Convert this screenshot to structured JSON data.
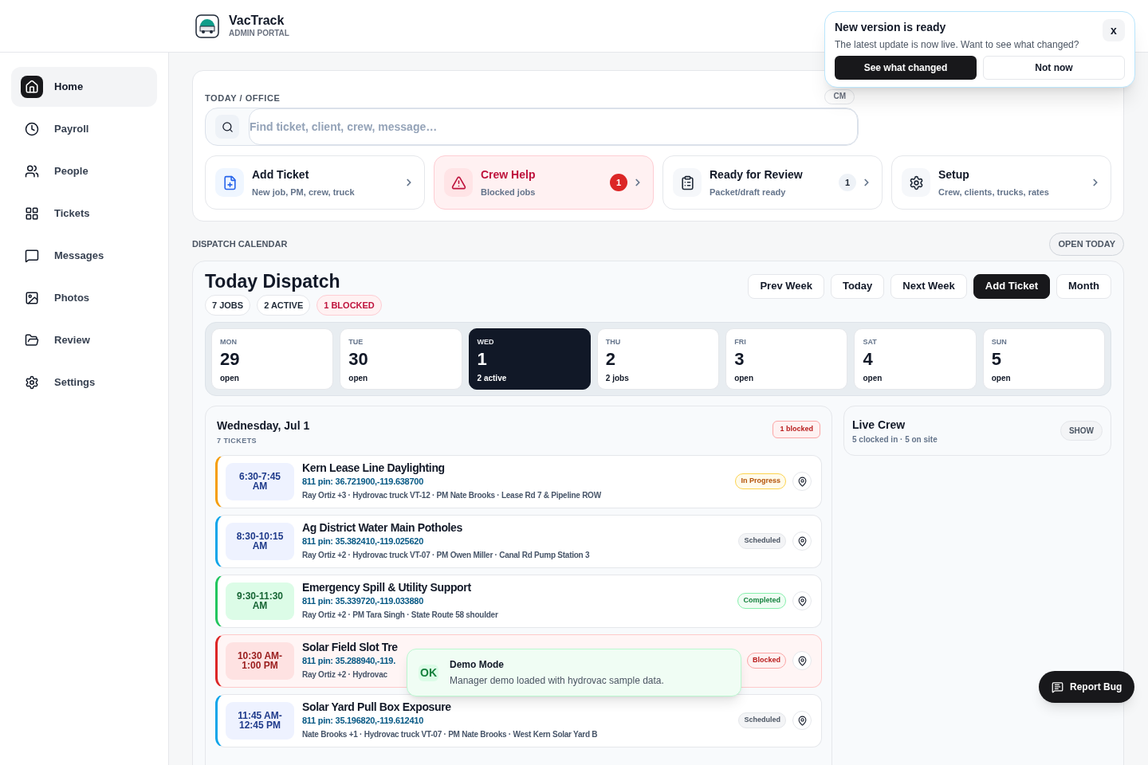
{
  "brand": {
    "name": "VacTrack",
    "subtitle": "ADMIN PORTAL"
  },
  "sidebar": {
    "items": [
      {
        "label": "Home",
        "selected": true
      },
      {
        "label": "Payroll",
        "selected": false
      },
      {
        "label": "People",
        "selected": false
      },
      {
        "label": "Tickets",
        "selected": false
      },
      {
        "label": "Messages",
        "selected": false
      },
      {
        "label": "Photos",
        "selected": false
      },
      {
        "label": "Review",
        "selected": false
      },
      {
        "label": "Settings",
        "selected": false
      }
    ]
  },
  "office": {
    "heading": "TODAY / OFFICE",
    "shortcut": "CM",
    "search": {
      "placeholder": "Find ticket, client, crew, message…"
    },
    "actions": [
      {
        "title": "Add Ticket",
        "subtitle": "New job, PM, crew, truck",
        "kind": "normal"
      },
      {
        "title": "Crew Help",
        "subtitle": "Blocked jobs",
        "kind": "alert",
        "count": "1"
      },
      {
        "title": "Ready for Review",
        "subtitle": "Packet/draft ready",
        "kind": "normal",
        "count": "1"
      },
      {
        "title": "Setup",
        "subtitle": "Crew, clients, trucks, rates",
        "kind": "normal"
      }
    ]
  },
  "calendar": {
    "section_label": "DISPATCH CALENDAR",
    "open_today": "OPEN TODAY",
    "title": "Today Dispatch",
    "chips": [
      {
        "label": "7 JOBS",
        "kind": "normal"
      },
      {
        "label": "2 ACTIVE",
        "kind": "normal"
      },
      {
        "label": "1 BLOCKED",
        "kind": "alert"
      }
    ],
    "buttons": [
      {
        "label": "Prev Week",
        "primary": false
      },
      {
        "label": "Today",
        "primary": false
      },
      {
        "label": "Next Week",
        "primary": false
      },
      {
        "label": "Add Ticket",
        "primary": true
      },
      {
        "label": "Month",
        "primary": false
      }
    ],
    "days": [
      {
        "weekday": "MON",
        "date": "29",
        "note": "open",
        "selected": false
      },
      {
        "weekday": "TUE",
        "date": "30",
        "note": "open",
        "selected": false
      },
      {
        "weekday": "WED",
        "date": "1",
        "note": "2 active",
        "selected": true
      },
      {
        "weekday": "THU",
        "date": "2",
        "note": "2 jobs",
        "selected": false
      },
      {
        "weekday": "FRI",
        "date": "3",
        "note": "open",
        "selected": false
      },
      {
        "weekday": "SAT",
        "date": "4",
        "note": "open",
        "selected": false
      },
      {
        "weekday": "SUN",
        "date": "5",
        "note": "open",
        "selected": false
      }
    ]
  },
  "day_panel": {
    "title": "Wednesday, Jul 1",
    "count": "7 TICKETS",
    "badge": "1 blocked",
    "tickets": [
      {
        "time": "6:30-7:45 AM",
        "title": "Kern Lease Line Daylighting",
        "pin": "811 pin: 36.721900,-119.638700",
        "details": "Ray Ortiz +3 · Hydrovac truck VT-12 · PM Nate Brooks · Lease Rd 7 & Pipeline ROW",
        "status": "In Progress",
        "kind": "progress"
      },
      {
        "time": "8:30-10:15 AM",
        "title": "Ag District Water Main Potholes",
        "pin": "811 pin: 35.382410,-119.025620",
        "details": "Ray Ortiz +2 · Hydrovac truck VT-07 · PM Owen Miller · Canal Rd Pump Station 3",
        "status": "Scheduled",
        "kind": "scheduled"
      },
      {
        "time": "9:30-11:30 AM",
        "title": "Emergency Spill & Utility Support",
        "pin": "811 pin: 35.339720,-119.033880",
        "details": "Ray Ortiz +2 · PM Tara Singh · State Route 58 shoulder",
        "status": "Completed",
        "kind": "completed"
      },
      {
        "time": "10:30 AM-1:00 PM",
        "title": "Solar Field Slot Tre",
        "pin": "811 pin: 35.288940,-119.",
        "details": "Ray Ortiz +2 · Hydrovac",
        "status": "Blocked",
        "kind": "blocked"
      },
      {
        "time": "11:45 AM-12:45 PM",
        "title": "Solar Yard Pull Box Exposure",
        "pin": "811 pin: 35.196820,-119.612410",
        "details": "Nate Brooks +1 · Hydrovac truck VT-07 · PM Nate Brooks · West Kern Solar Yard B",
        "status": "Scheduled",
        "kind": "scheduled"
      }
    ]
  },
  "live_crew": {
    "title": "Live Crew",
    "summary": "5 clocked in · 5 on site",
    "button": "SHOW"
  },
  "update_popup": {
    "title": "New version is ready",
    "message": "The latest update is now live. Want to see what changed?",
    "close": "x",
    "primary": "See what changed",
    "secondary": "Not now"
  },
  "toast": {
    "badge": "OK",
    "title": "Demo Mode",
    "message": "Manager demo loaded with hydrovac sample data."
  },
  "report_bug": "Report Bug"
}
